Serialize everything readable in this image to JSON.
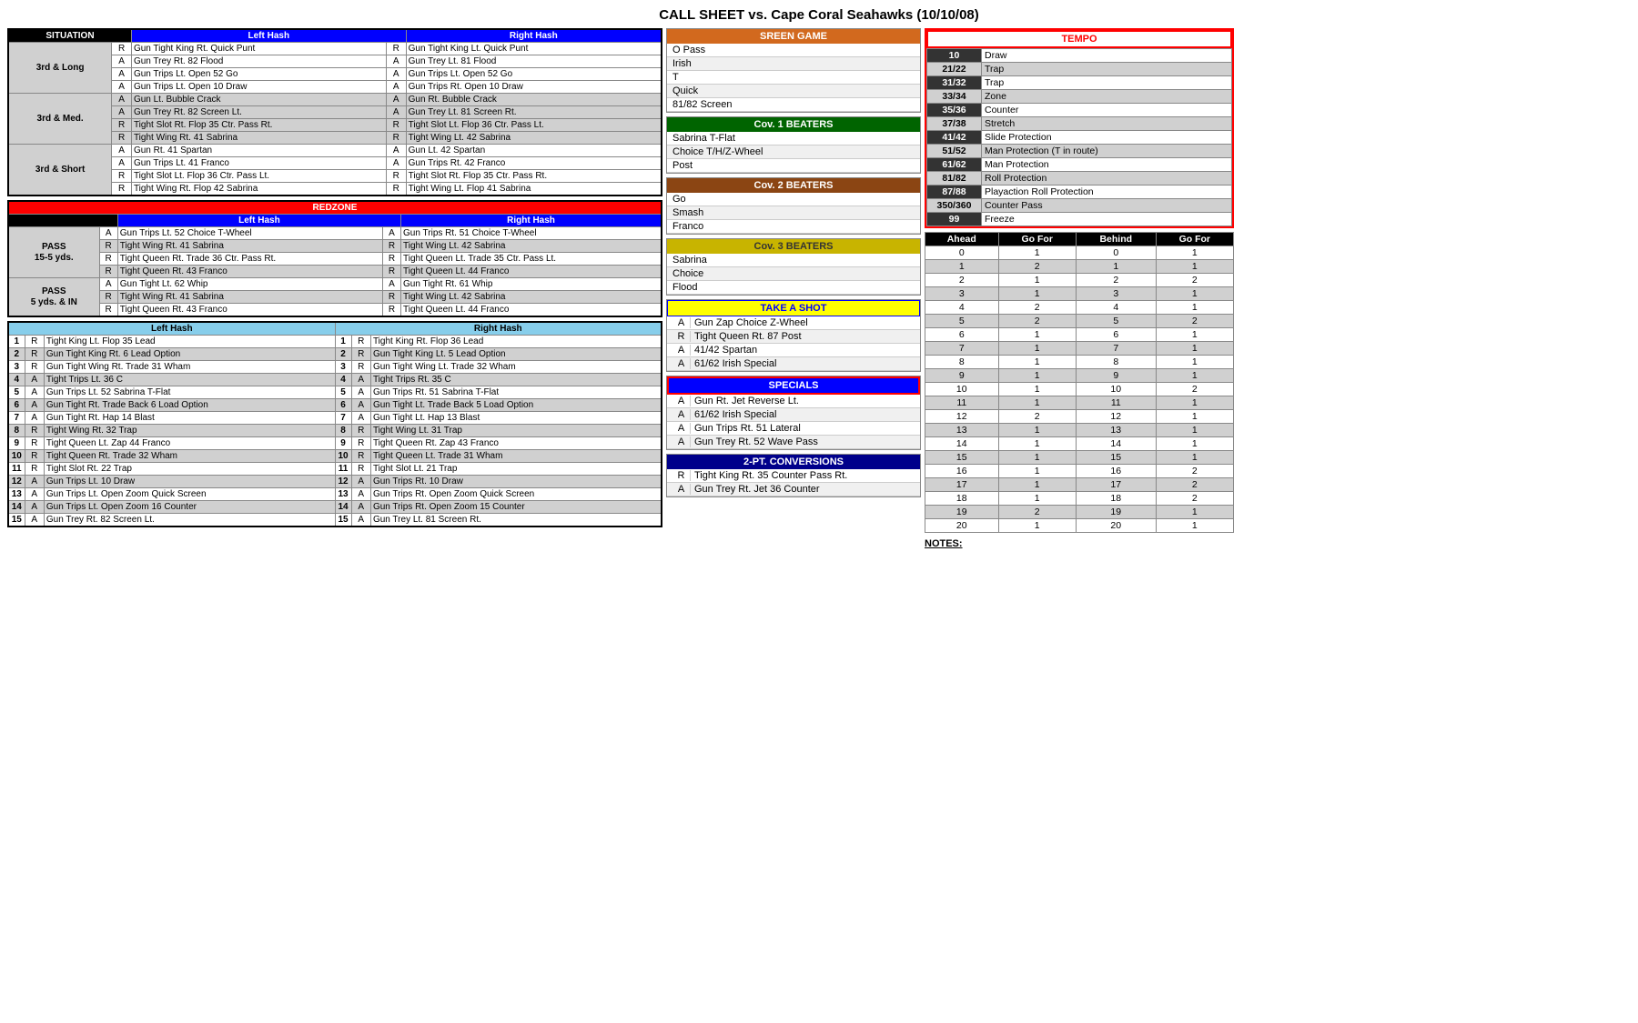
{
  "title": "CALL SHEET vs. Cape Coral Seahawks (10/10/08)",
  "situation": {
    "col_situation": "SITUATION",
    "col_lefthash": "Left Hash",
    "col_righthash": "Right Hash",
    "rows": [
      {
        "label": "3rd & Long",
        "plays": [
          {
            "ra": "R",
            "left": "Gun Tight King Rt. Quick Punt",
            "right": "Gun Tight King Lt. Quick Punt"
          },
          {
            "ra": "A",
            "left": "Gun Trey Rt. 82 Flood",
            "right": "Gun Trey Lt. 81 Flood"
          },
          {
            "ra": "A",
            "left": "Gun Trips Lt. Open 52 Go",
            "right": "Gun Trips Lt. Open 52 Go"
          },
          {
            "ra": "A",
            "left": "Gun Trips Lt. Open 10 Draw",
            "right": "Gun Trips Rt. Open 10 Draw"
          }
        ]
      },
      {
        "label": "3rd & Med.",
        "plays": [
          {
            "ra": "A",
            "left": "Gun Lt. Bubble Crack",
            "right": "Gun Rt. Bubble Crack"
          },
          {
            "ra": "A",
            "left": "Gun Trey Rt. 82 Screen Lt.",
            "right": "Gun Trey Lt. 81 Screen Rt."
          },
          {
            "ra": "R",
            "left": "Tight Slot Rt. Flop 35 Ctr. Pass Rt.",
            "right": "Tight Slot Lt. Flop 36 Ctr. Pass Lt."
          },
          {
            "ra": "R",
            "left": "Tight Wing Rt. 41 Sabrina",
            "right": "Tight Wing Lt. 42 Sabrina"
          }
        ]
      },
      {
        "label": "3rd & Short",
        "plays": [
          {
            "ra": "A",
            "left": "Gun Rt. 41 Spartan",
            "right": "Gun Lt. 42 Spartan"
          },
          {
            "ra": "A",
            "left": "Gun Trips Lt. 41 Franco",
            "right": "Gun Trips Rt. 42 Franco"
          },
          {
            "ra": "R",
            "left": "Tight Slot Lt. Flop 36 Ctr. Pass Lt.",
            "right": "Tight Slot Rt. Flop 35 Ctr. Pass Rt."
          },
          {
            "ra": "R",
            "left": "Tight Wing Rt. Flop 42 Sabrina",
            "right": "Tight Wing Lt. Flop 41 Sabrina"
          }
        ]
      }
    ]
  },
  "redzone": {
    "header": "REDZONE",
    "col_lefthash": "Left Hash",
    "col_righthash": "Right Hash",
    "pass1_label": "PASS\n15-5 yds.",
    "pass2_label": "PASS\n5 yds. & IN",
    "pass1_plays": [
      {
        "ra": "A",
        "left": "Gun Trips Lt. 52 Choice T-Wheel",
        "right": "Gun Trips Rt. 51 Choice T-Wheel"
      },
      {
        "ra": "R",
        "left": "Tight Wing Rt. 41 Sabrina",
        "right": "Tight Wing Lt. 42 Sabrina"
      },
      {
        "ra": "R",
        "left": "Tight Queen Rt. Trade 36 Ctr. Pass Rt.",
        "right": "Tight Queen Lt. Trade 35 Ctr. Pass Lt."
      },
      {
        "ra": "R",
        "left": "Tight Queen Rt. 43 Franco",
        "right": "Tight Queen Lt. 44 Franco"
      }
    ],
    "pass2_plays": [
      {
        "ra": "A",
        "left": "Gun Tight Lt. 62 Whip",
        "right": "Gun Tight Rt. 61 Whip"
      },
      {
        "ra": "R",
        "left": "Tight Wing Rt. 41 Sabrina",
        "right": "Tight Wing Lt. 42 Sabrina"
      },
      {
        "ra": "R",
        "left": "Tight Queen Rt. 43 Franco",
        "right": "Tight Queen Lt. 44 Franco"
      }
    ]
  },
  "numbered": {
    "col_lefthash": "Left Hash",
    "col_righthash": "Right Hash",
    "plays": [
      {
        "num": 1,
        "ra_l": "R",
        "left": "Tight King Lt. Flop 35 Lead",
        "ra_r": "R",
        "right": "Tight King Rt. Flop 36 Lead"
      },
      {
        "num": 2,
        "ra_l": "R",
        "left": "Gun Tight King Rt. 6 Lead Option",
        "ra_r": "R",
        "right": "Gun Tight King Lt. 5 Lead Option"
      },
      {
        "num": 3,
        "ra_l": "R",
        "left": "Gun Tight Wing Rt. Trade 31 Wham",
        "ra_r": "R",
        "right": "Gun Tight Wing Lt. Trade 32 Wham"
      },
      {
        "num": 4,
        "ra_l": "A",
        "left": "Tight Trips Lt. 36 C",
        "ra_r": "A",
        "right": "Tight Trips Rt. 35 C"
      },
      {
        "num": 5,
        "ra_l": "A",
        "left": "Gun Trips Lt. 52 Sabrina T-Flat",
        "ra_r": "A",
        "right": "Gun Trips Rt. 51 Sabrina T-Flat"
      },
      {
        "num": 6,
        "ra_l": "A",
        "left": "Gun Tight Rt. Trade Back 6 Load Option",
        "ra_r": "A",
        "right": "Gun Tight Lt. Trade Back 5 Load Option"
      },
      {
        "num": 7,
        "ra_l": "A",
        "left": "Gun Tight Rt. Hap 14 Blast",
        "ra_r": "A",
        "right": "Gun Tight Lt. Hap 13 Blast"
      },
      {
        "num": 8,
        "ra_l": "R",
        "left": "Tight Wing Rt. 32 Trap",
        "ra_r": "R",
        "right": "Tight Wing Lt. 31 Trap"
      },
      {
        "num": 9,
        "ra_l": "R",
        "left": "Tight Queen Lt. Zap 44 Franco",
        "ra_r": "R",
        "right": "Tight Queen Rt. Zap 43 Franco"
      },
      {
        "num": 10,
        "ra_l": "R",
        "left": "Tight Queen Rt. Trade 32 Wham",
        "ra_r": "R",
        "right": "Tight Queen Lt. Trade 31 Wham"
      },
      {
        "num": 11,
        "ra_l": "R",
        "left": "Tight Slot Rt. 22 Trap",
        "ra_r": "R",
        "right": "Tight Slot Lt. 21 Trap"
      },
      {
        "num": 12,
        "ra_l": "A",
        "left": "Gun Trips Lt. 10 Draw",
        "ra_r": "A",
        "right": "Gun Trips Rt. 10 Draw"
      },
      {
        "num": 13,
        "ra_l": "A",
        "left": "Gun Trips Lt. Open Zoom Quick Screen",
        "ra_r": "A",
        "right": "Gun Trips Rt. Open Zoom Quick Screen"
      },
      {
        "num": 14,
        "ra_l": "A",
        "left": "Gun Trips Lt. Open Zoom 16 Counter",
        "ra_r": "A",
        "right": "Gun Trips Rt. Open Zoom 15 Counter"
      },
      {
        "num": 15,
        "ra_l": "A",
        "left": "Gun Trey Rt. 82 Screen Lt.",
        "ra_r": "A",
        "right": "Gun Trey Lt. 81 Screen Rt."
      }
    ]
  },
  "screen_game": {
    "header": "SREEN GAME",
    "plays": [
      "O Pass",
      "Irish",
      "T",
      "Quick",
      "81/82 Screen"
    ]
  },
  "cov1_beaters": {
    "header": "Cov. 1 BEATERS",
    "plays": [
      "Sabrina T-Flat",
      "Choice T/H/Z-Wheel",
      "Post"
    ]
  },
  "cov2_beaters": {
    "header": "Cov. 2 BEATERS",
    "plays": [
      "Go",
      "Smash",
      "Franco"
    ]
  },
  "cov3_beaters": {
    "header": "Cov. 3 BEATERS",
    "plays": [
      "Sabrina",
      "Choice",
      "Flood"
    ]
  },
  "take_a_shot": {
    "header": "TAKE A SHOT",
    "plays": [
      {
        "ra": "A",
        "play": "Gun Zap Choice Z-Wheel"
      },
      {
        "ra": "R",
        "play": "Tight Queen Rt. 87 Post"
      },
      {
        "ra": "A",
        "play": "41/42 Spartan"
      },
      {
        "ra": "A",
        "play": "61/62 Irish Special"
      }
    ]
  },
  "specials": {
    "header": "SPECIALS",
    "plays": [
      {
        "ra": "A",
        "play": "Gun Rt. Jet Reverse Lt."
      },
      {
        "ra": "A",
        "play": "61/62 Irish Special"
      },
      {
        "ra": "A",
        "play": "Gun Trips Rt. 51 Lateral"
      },
      {
        "ra": "A",
        "play": "Gun Trey Rt. 52 Wave Pass"
      }
    ]
  },
  "two_pt": {
    "header": "2-PT. CONVERSIONS",
    "plays": [
      {
        "ra": "R",
        "play": "Tight King Rt. 35 Counter Pass Rt."
      },
      {
        "ra": "A",
        "play": "Gun Trey Rt. Jet 36 Counter"
      }
    ]
  },
  "tempo": {
    "header": "TEMPO",
    "rows": [
      {
        "num": "10",
        "play": "Draw",
        "dark": true
      },
      {
        "num": "21/22",
        "play": "Trap",
        "dark": false
      },
      {
        "num": "31/32",
        "play": "Trap",
        "dark": true
      },
      {
        "num": "33/34",
        "play": "Zone",
        "dark": false
      },
      {
        "num": "35/36",
        "play": "Counter",
        "dark": true
      },
      {
        "num": "37/38",
        "play": "Stretch",
        "dark": false
      },
      {
        "num": "41/42",
        "play": "Slide Protection",
        "dark": true
      },
      {
        "num": "51/52",
        "play": "Man Protection (T in route)",
        "dark": false
      },
      {
        "num": "61/62",
        "play": "Man Protection",
        "dark": true
      },
      {
        "num": "81/82",
        "play": "Roll Protection",
        "dark": false
      },
      {
        "num": "87/88",
        "play": "Playaction Roll Protection",
        "dark": true
      },
      {
        "num": "350/360",
        "play": "Counter Pass",
        "dark": false
      },
      {
        "num": "99",
        "play": "Freeze",
        "dark": true
      }
    ]
  },
  "gofor": {
    "headers": [
      "Ahead",
      "Go For",
      "Behind",
      "Go For"
    ],
    "rows": [
      {
        "ahead": "0",
        "gf1": "1",
        "behind": "0",
        "gf2": "1"
      },
      {
        "ahead": "1",
        "gf1": "2",
        "behind": "1",
        "gf2": "1"
      },
      {
        "ahead": "2",
        "gf1": "1",
        "behind": "2",
        "gf2": "2"
      },
      {
        "ahead": "3",
        "gf1": "1",
        "behind": "3",
        "gf2": "1"
      },
      {
        "ahead": "4",
        "gf1": "2",
        "behind": "4",
        "gf2": "1"
      },
      {
        "ahead": "5",
        "gf1": "2",
        "behind": "5",
        "gf2": "2"
      },
      {
        "ahead": "6",
        "gf1": "1",
        "behind": "6",
        "gf2": "1"
      },
      {
        "ahead": "7",
        "gf1": "1",
        "behind": "7",
        "gf2": "1"
      },
      {
        "ahead": "8",
        "gf1": "1",
        "behind": "8",
        "gf2": "1"
      },
      {
        "ahead": "9",
        "gf1": "1",
        "behind": "9",
        "gf2": "1"
      },
      {
        "ahead": "10",
        "gf1": "1",
        "behind": "10",
        "gf2": "2"
      },
      {
        "ahead": "11",
        "gf1": "1",
        "behind": "11",
        "gf2": "1"
      },
      {
        "ahead": "12",
        "gf1": "2",
        "behind": "12",
        "gf2": "1"
      },
      {
        "ahead": "13",
        "gf1": "1",
        "behind": "13",
        "gf2": "1"
      },
      {
        "ahead": "14",
        "gf1": "1",
        "behind": "14",
        "gf2": "1"
      },
      {
        "ahead": "15",
        "gf1": "1",
        "behind": "15",
        "gf2": "1"
      },
      {
        "ahead": "16",
        "gf1": "1",
        "behind": "16",
        "gf2": "2"
      },
      {
        "ahead": "17",
        "gf1": "1",
        "behind": "17",
        "gf2": "2"
      },
      {
        "ahead": "18",
        "gf1": "1",
        "behind": "18",
        "gf2": "2"
      },
      {
        "ahead": "19",
        "gf1": "2",
        "behind": "19",
        "gf2": "1"
      },
      {
        "ahead": "20",
        "gf1": "1",
        "behind": "20",
        "gf2": "1"
      }
    ]
  },
  "notes_label": "NOTES:"
}
